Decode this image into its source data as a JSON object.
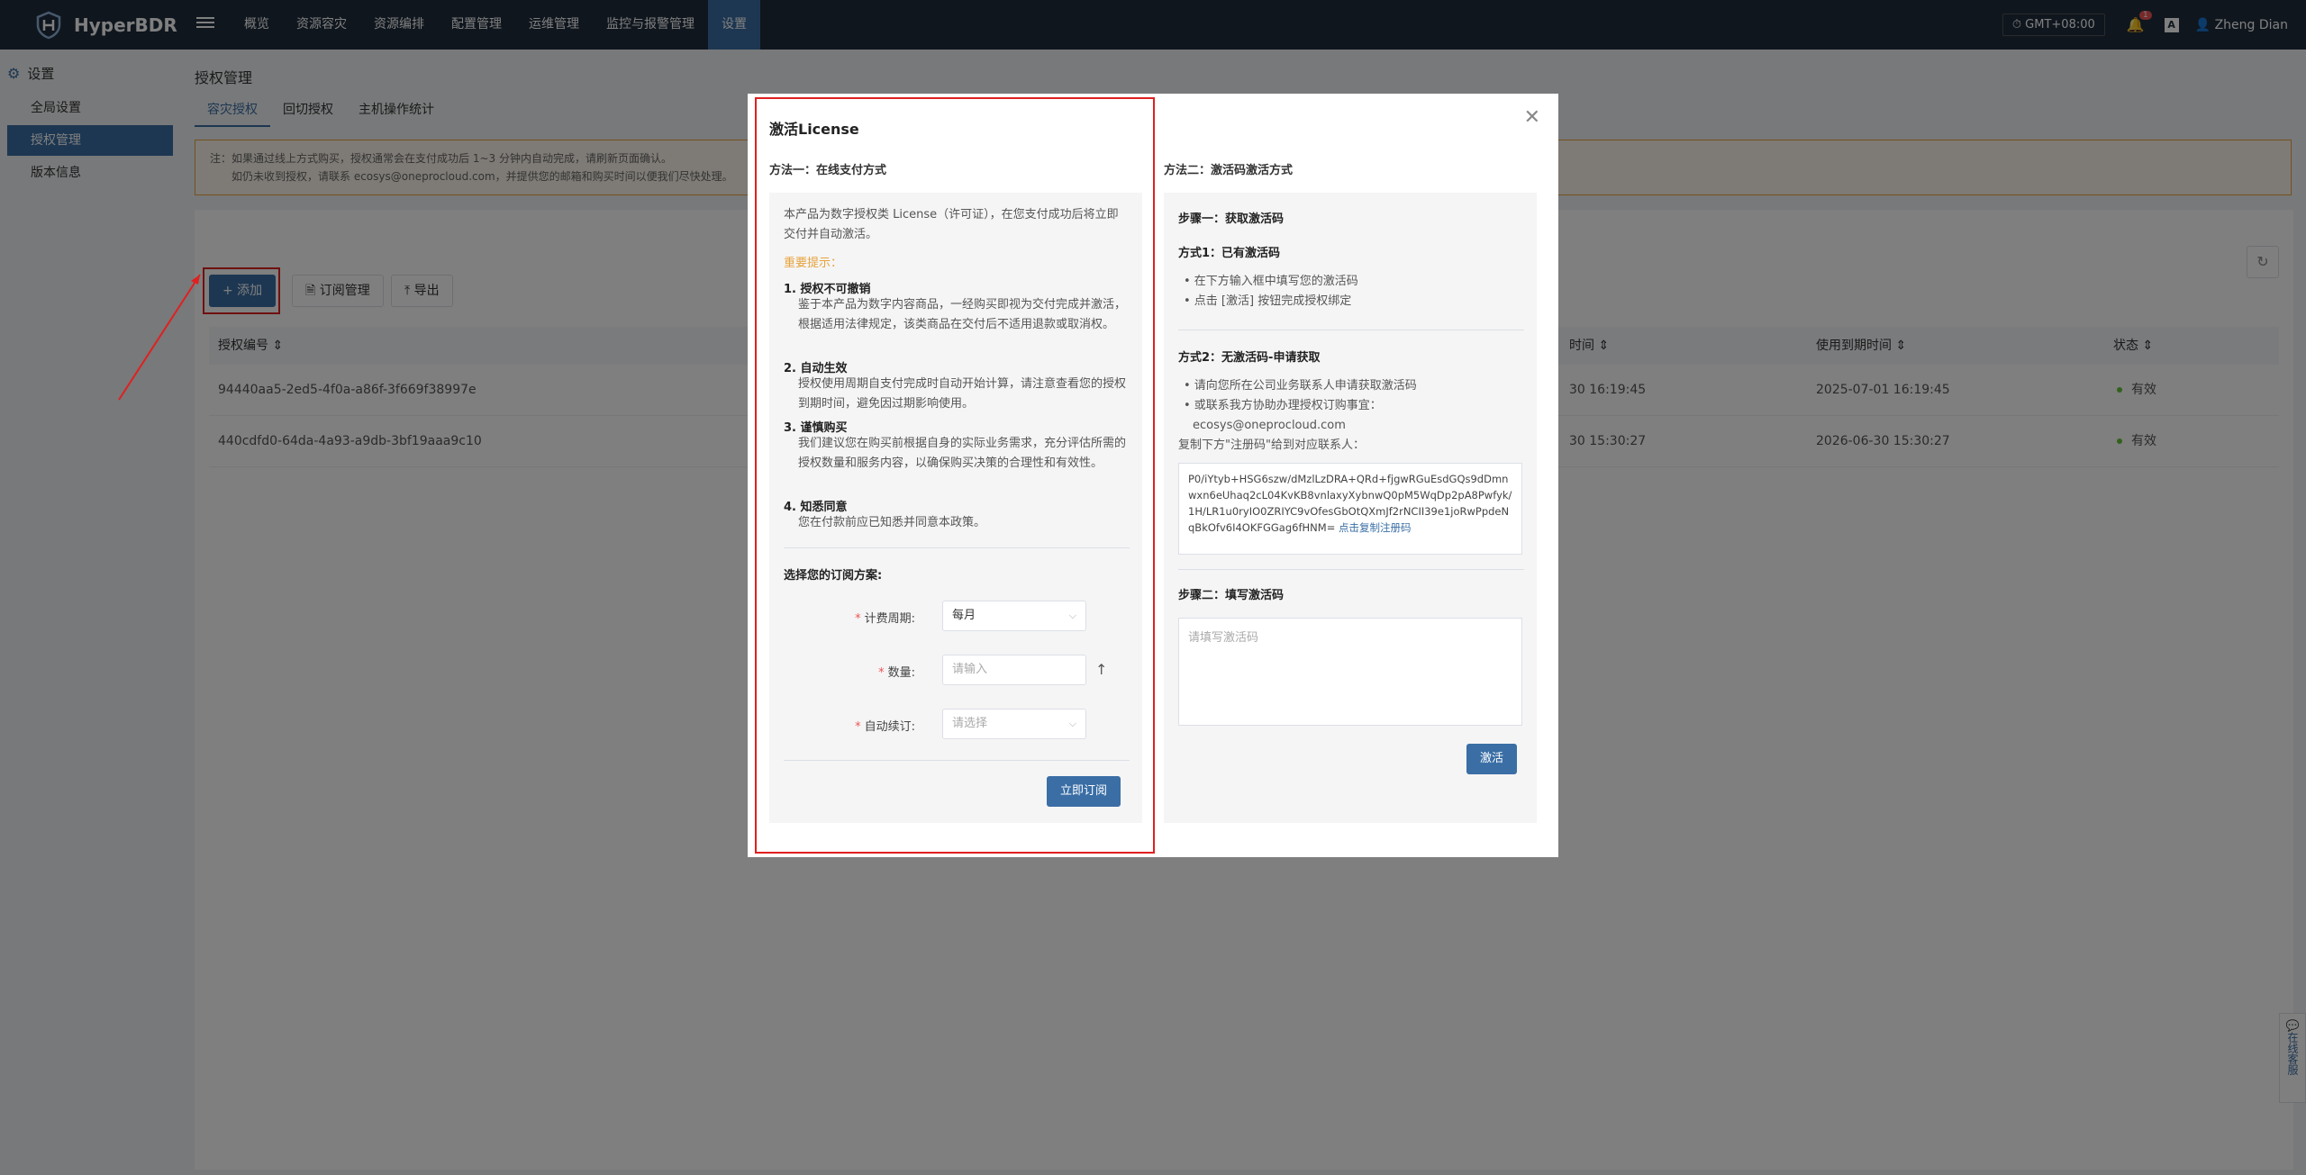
{
  "app": {
    "name": "HyperBDR"
  },
  "nav": {
    "items": [
      "概览",
      "资源容灾",
      "资源编排",
      "配置管理",
      "运维管理",
      "监控与报警管理",
      "设置"
    ],
    "active_index": 6
  },
  "topright": {
    "timezone": "GMT+08:00",
    "bell_count": "1",
    "lang": "A",
    "user": "Zheng Dian"
  },
  "sidebar": {
    "title": "设置",
    "items": [
      "全局设置",
      "授权管理",
      "版本信息"
    ],
    "active_index": 1
  },
  "page": {
    "title": "授权管理",
    "tabs": [
      "容灾授权",
      "回切授权",
      "主机操作统计"
    ],
    "active_tab": 0,
    "notice_line1": "注：如果通过线上方式购买，授权通常会在支付成功后 1~3 分钟内自动完成，请刷新页面确认。",
    "notice_line2": "如仍未收到授权，请联系 ecosys@oneprocloud.com，并提供您的邮箱和购买时间以便我们尽快处理。"
  },
  "toolbar": {
    "add": "+ 添加",
    "subscription": "订阅管理",
    "export": "导出"
  },
  "table": {
    "headers": {
      "id": "授权编号",
      "time": "时间",
      "expire": "使用到期时间",
      "status": "状态"
    },
    "rows": [
      {
        "id": "94440aa5-2ed5-4f0a-a86f-3f669f38997e",
        "time": "30 16:19:45",
        "expire": "2025-07-01 16:19:45",
        "status": "有效"
      },
      {
        "id": "440cdfd0-64da-4a93-a9db-3bf19aaa9c10",
        "time": "30 15:30:27",
        "expire": "2026-06-30 15:30:27",
        "status": "有效"
      }
    ]
  },
  "modal": {
    "title": "激活License",
    "method1": {
      "title": "方法一：在线支付方式",
      "intro": "本产品为数字授权类 License（许可证），在您支付成功后将立即交付并自动激活。",
      "important": "重要提示：",
      "points": [
        {
          "title": "1. 授权不可撤销",
          "body": "鉴于本产品为数字内容商品，一经购买即视为交付完成并激活，根据适用法律规定，该类商品在交付后不适用退款或取消权。"
        },
        {
          "title": "2. 自动生效",
          "body": "授权使用周期自支付完成时自动开始计算，请注意查看您的授权到期时间，避免因过期影响使用。"
        },
        {
          "title": "3. 谨慎购买",
          "body": "我们建议您在购买前根据自身的实际业务需求，充分评估所需的授权数量和服务内容，以确保购买决策的合理性和有效性。"
        },
        {
          "title": "4. 知悉同意",
          "body": "您在付款前应已知悉并同意本政策。"
        }
      ],
      "plan_title": "选择您的订阅方案:",
      "billing_label": "计费周期:",
      "billing_value": "每月",
      "qty_label": "数量:",
      "qty_placeholder": "请输入",
      "renew_label": "自动续订:",
      "renew_placeholder": "请选择",
      "subscribe": "立即订阅"
    },
    "method2": {
      "title": "方法二：激活码激活方式",
      "step1": "步骤一：获取激活码",
      "way1": "方式1：已有激活码",
      "way1_items": [
        "• 在下方输入框中填写您的激活码",
        "• 点击 [激活] 按钮完成授权绑定"
      ],
      "way2": "方式2：无激活码-申请获取",
      "way2_items": [
        "• 请向您所在公司业务联系人申请获取激活码",
        "• 或联系我方协助办理授权订购事宜："
      ],
      "email": "ecosys@oneprocloud.com",
      "copy_hint": "复制下方\"注册码\"给到对应联系人：",
      "reg_code": "P0/iYtyb+HSG6szw/dMzlLzDRA+QRd+fjgwRGuEsdGQs9dDmnwxn6eUhaq2cL04KvKB8vnlaxyXybnwQ0pM5WqDp2pA8Pwfyk/1H/LR1u0ryIO0ZRIYC9vOfesGbOtQXmJf2rNCII39e1joRwPpdeNqBkOfv6I4OKFGGag6fHNM=",
      "copy_link": "点击复制注册码",
      "step2": "步骤二：填写激活码",
      "code_placeholder": "请填写激活码",
      "activate": "激活"
    }
  },
  "float_tab": "在线客服",
  "colors": {
    "nav_bg": "#1f2d3d",
    "primary": "#3a6ea5",
    "highlight": "#e02020"
  }
}
